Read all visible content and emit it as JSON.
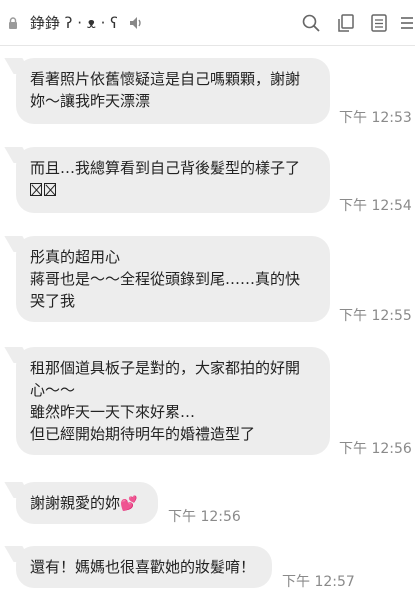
{
  "header": {
    "title": "錚錚 ʔ · ᴥ · ʕ",
    "icons": [
      "lock-icon",
      "mute-icon",
      "search-icon",
      "copy-icon",
      "notes-icon",
      "menu-icon"
    ]
  },
  "messages": [
    {
      "lines": [
        "看著照片依舊懷疑這是自己嗎顆顆，謝謝",
        "妳～讓我昨天漂漂"
      ],
      "time": "下午 12:53"
    },
    {
      "lines": [
        "而且…我總算看到自己背後髮型的樣子了"
      ],
      "boxes": 2,
      "time": "下午 12:54"
    },
    {
      "lines": [
        "彤真的超用心",
        "蔣哥也是～～全程從頭錄到尾……真的快",
        "哭了我"
      ],
      "time": "下午 12:55"
    },
    {
      "lines": [
        "租那個道具板子是對的，大家都拍的好開",
        "心～～",
        "雖然昨天一天下來好累…",
        "但已經開始期待明年的婚禮造型了"
      ],
      "time": "下午 12:56"
    },
    {
      "lines": [
        "謝謝親愛的妳"
      ],
      "emoji": "💕",
      "time": "下午 12:56"
    },
    {
      "lines": [
        "還有！媽媽也很喜歡她的妝髮唷！"
      ],
      "time": "下午 12:57"
    }
  ],
  "colors": {
    "bubble": "#ededed",
    "time": "#8a8a8a"
  }
}
